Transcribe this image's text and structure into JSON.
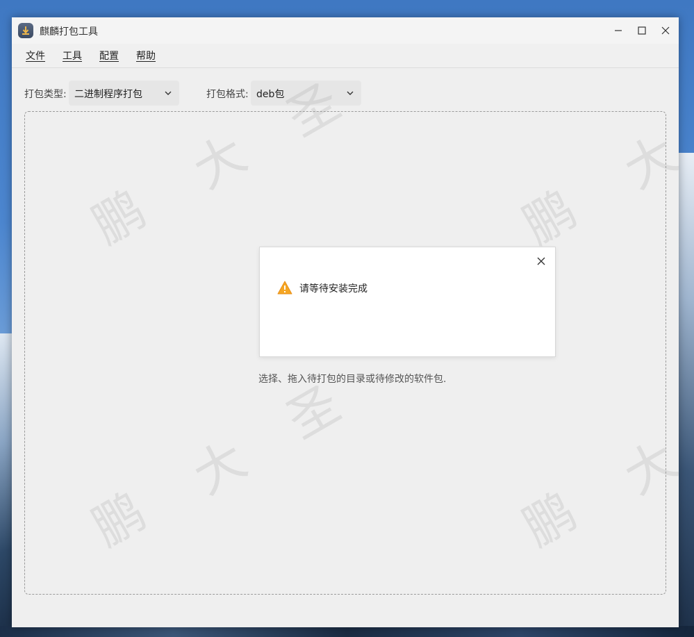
{
  "window": {
    "title": "麒麟打包工具"
  },
  "menu": {
    "items": [
      "文件",
      "工具",
      "配置",
      "帮助"
    ]
  },
  "toolbar": {
    "type_label": "打包类型:",
    "type_value": "二进制程序打包",
    "format_label": "打包格式:",
    "format_value": "deb包"
  },
  "dropzone": {
    "hint": "选择、拖入待打包的目录或待修改的软件包."
  },
  "dialog": {
    "message": "请等待安装完成",
    "icon": "warning-icon"
  },
  "watermark": {
    "chars": [
      "鹏",
      "大",
      "圣"
    ]
  },
  "colors": {
    "warning": "#f5a623",
    "window_bg": "#efefef"
  }
}
